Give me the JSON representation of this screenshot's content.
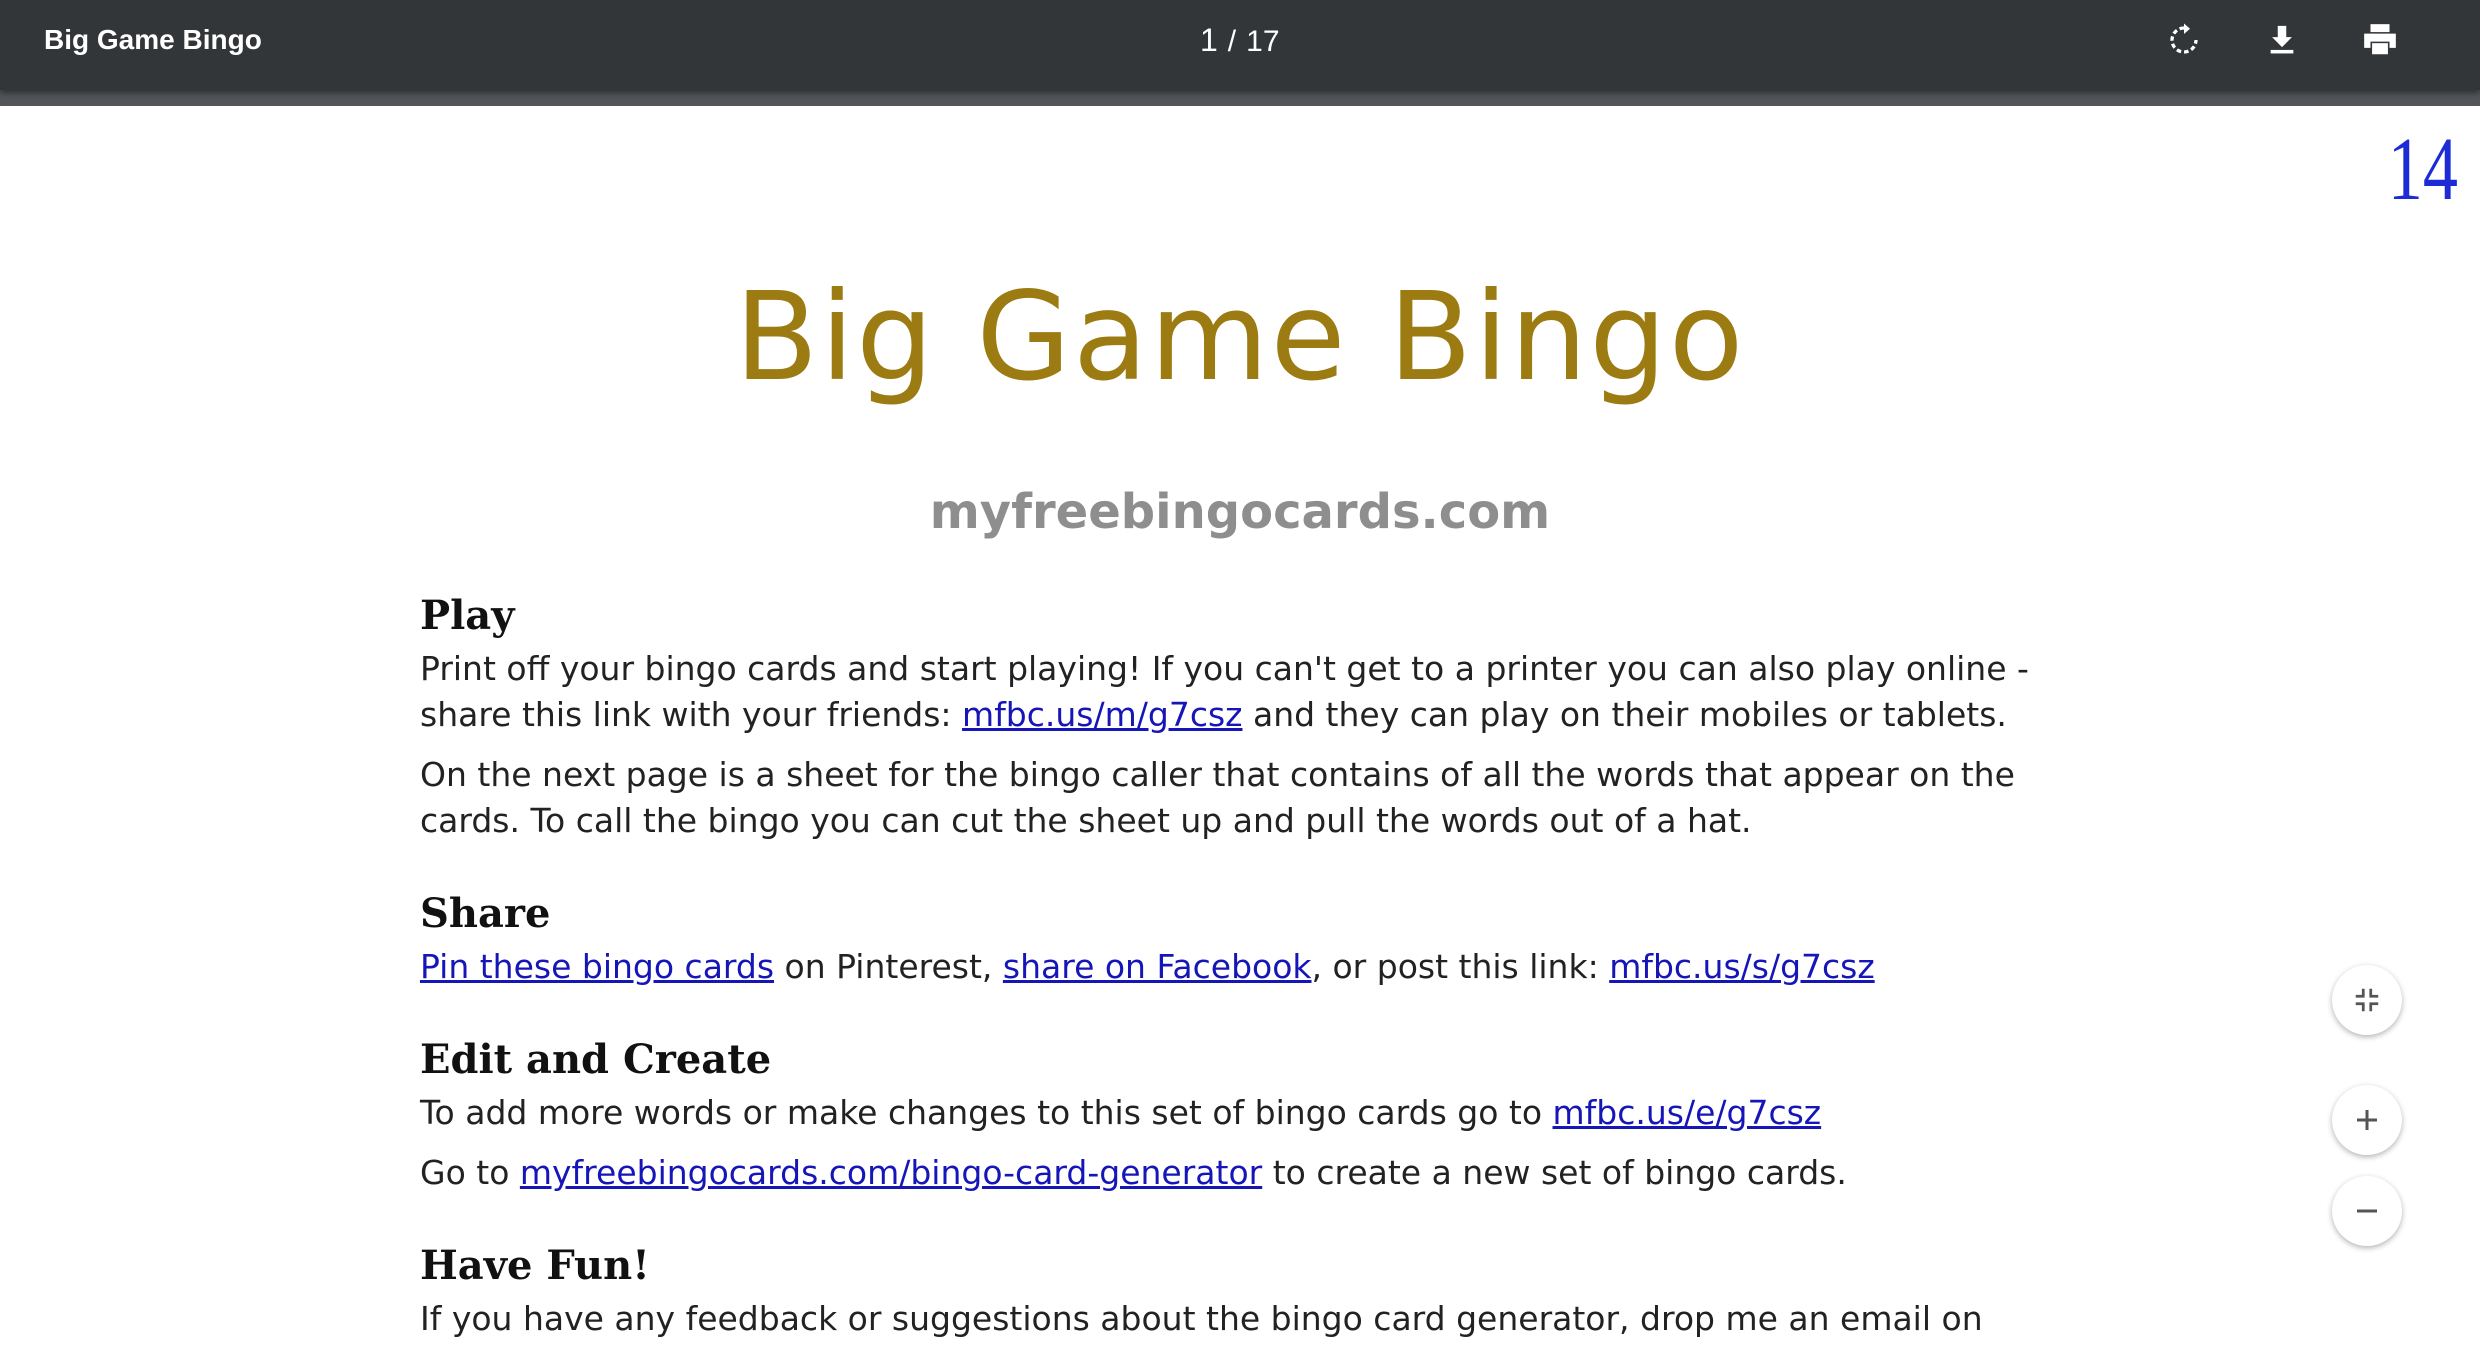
{
  "toolbar": {
    "title": "Big Game Bingo",
    "current_page": "1",
    "separator": "/",
    "total_pages": "17",
    "icons": [
      "rotate-icon",
      "download-icon",
      "print-icon"
    ]
  },
  "page": {
    "corner_number": "14",
    "title": "Big Game Bingo",
    "site": "myfreebingocards.com",
    "play": {
      "heading": "Play",
      "p1_text1": "Print off your bingo cards and start playing! If you can't get to a printer you can also play online - share this link with your friends: ",
      "p1_link": "mfbc.us/m/g7csz",
      "p1_text2": " and they can play on their mobiles or tablets.",
      "p2": "On the next page is a sheet for the bingo caller that contains of all the words that appear on the cards. To call the bingo you can cut the sheet up and pull the words out of a hat."
    },
    "share": {
      "heading": "Share",
      "link1": "Pin these bingo cards",
      "text1": " on Pinterest, ",
      "link2": "share on Facebook",
      "text2": ", or post this link: ",
      "link3": "mfbc.us/s/g7csz"
    },
    "edit": {
      "heading": "Edit and Create",
      "p1_text": "To add more words or make changes to this set of bingo cards go to ",
      "p1_link": "mfbc.us/e/g7csz",
      "p2_text1": "Go to ",
      "p2_link": "myfreebingocards.com/bingo-card-generator",
      "p2_text2": " to create a new set of bingo cards."
    },
    "fun": {
      "heading": "Have Fun!",
      "p1": "If you have any feedback or suggestions about the bingo card generator, drop me an email on"
    }
  },
  "colors": {
    "toolbar_bg": "#323639",
    "title_gold": "#9c7c12",
    "link_blue": "#1515b8",
    "corner_blue": "#1c2bd6"
  },
  "zoom_controls": [
    "fit-page-icon",
    "zoom-in-icon",
    "zoom-out-icon"
  ]
}
